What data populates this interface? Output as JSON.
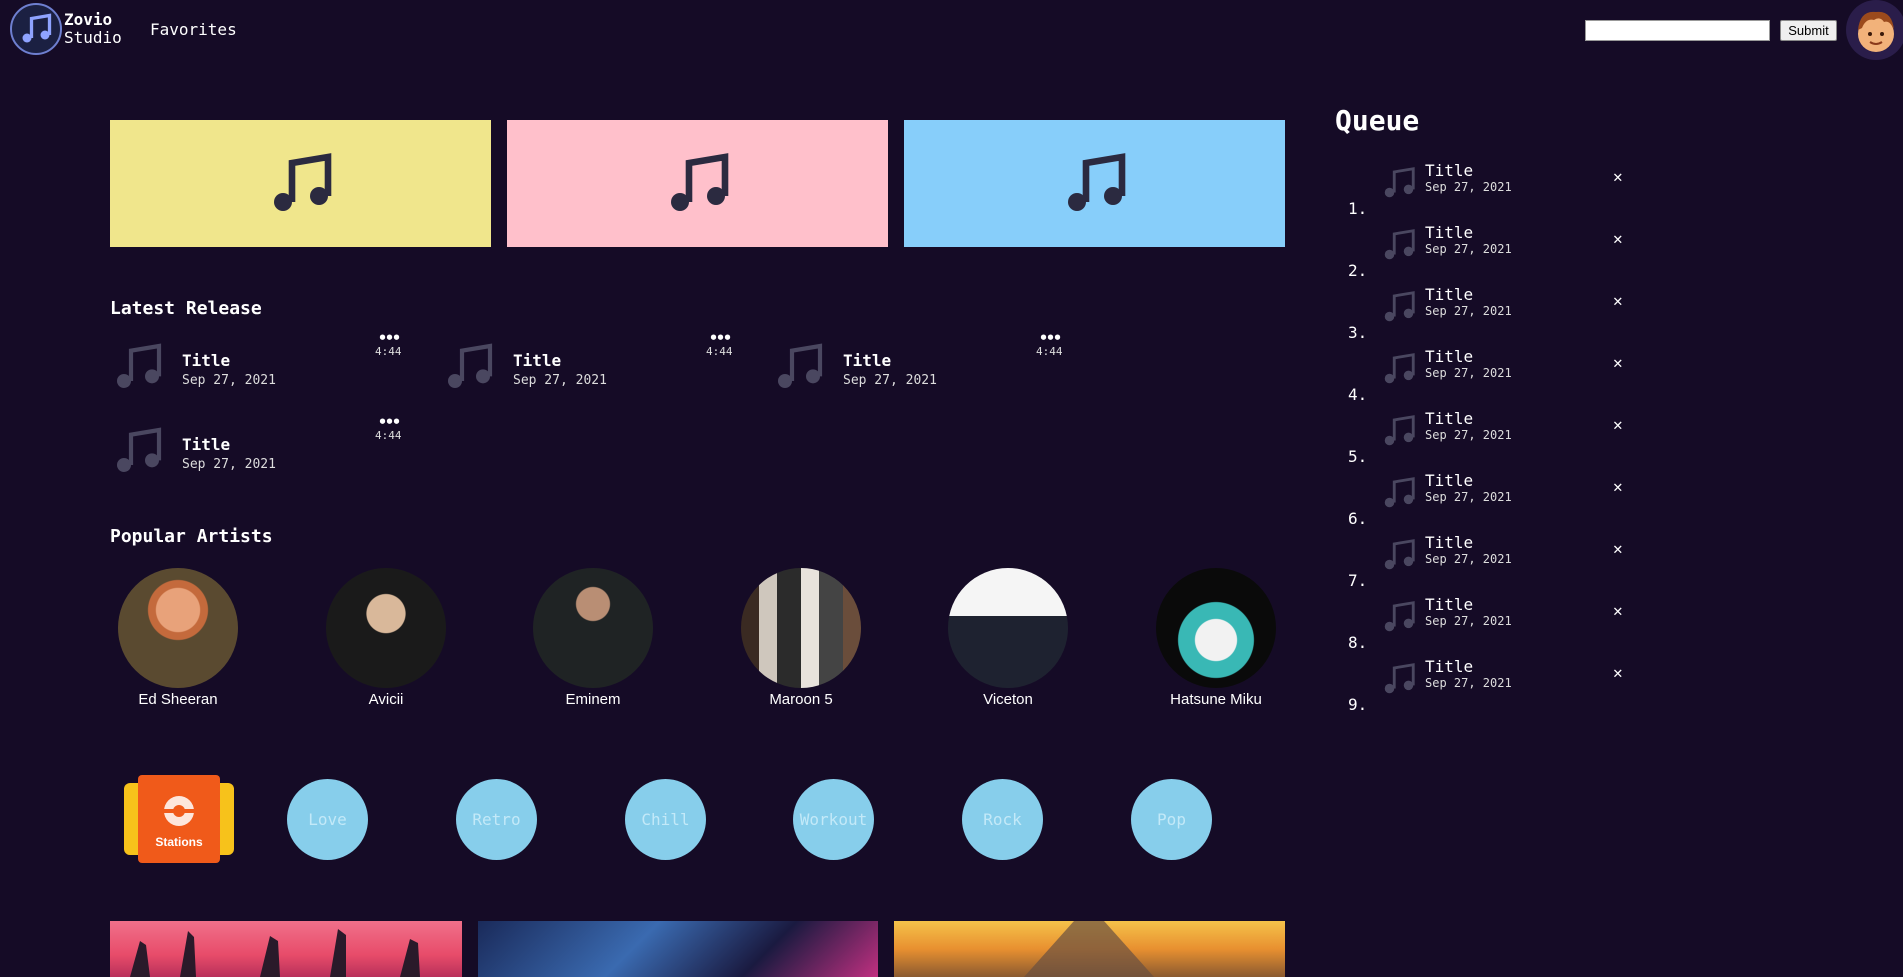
{
  "header": {
    "logo_line1": "Zovio",
    "logo_line2": "Studio",
    "nav_favorites": "Favorites",
    "search_value": "",
    "submit_label": "Submit"
  },
  "featured": [
    {
      "color": "#f0e68c",
      "icon": "music-note-icon"
    },
    {
      "color": "#ffc0cb",
      "icon": "music-note-icon"
    },
    {
      "color": "#87cefa",
      "icon": "music-note-icon"
    }
  ],
  "latest": {
    "title": "Latest Release",
    "items": [
      {
        "title": "Title",
        "date": "Sep 27, 2021",
        "more": "•••",
        "duration": "4:44"
      },
      {
        "title": "Title",
        "date": "Sep 27, 2021",
        "more": "•••",
        "duration": "4:44"
      },
      {
        "title": "Title",
        "date": "Sep 27, 2021",
        "more": "•••",
        "duration": "4:44"
      },
      {
        "title": "Title",
        "date": "Sep 27, 2021",
        "more": "•••",
        "duration": "4:44"
      }
    ]
  },
  "artists": {
    "title": "Popular Artists",
    "items": [
      {
        "name": "Ed Sheeran"
      },
      {
        "name": "Avicii"
      },
      {
        "name": "Eminem"
      },
      {
        "name": "Maroon 5"
      },
      {
        "name": "Viceton"
      },
      {
        "name": "Hatsune Miku"
      }
    ]
  },
  "stations": {
    "label": "Stations"
  },
  "genres": [
    "Love",
    "Retro",
    "Chill",
    "Workout",
    "Rock",
    "Pop"
  ],
  "queue": {
    "title": "Queue",
    "items": [
      {
        "num": "1.",
        "title": "Title",
        "date": "Sep 27, 2021",
        "close": "✕"
      },
      {
        "num": "2.",
        "title": "Title",
        "date": "Sep 27, 2021",
        "close": "✕"
      },
      {
        "num": "3.",
        "title": "Title",
        "date": "Sep 27, 2021",
        "close": "✕"
      },
      {
        "num": "4.",
        "title": "Title",
        "date": "Sep 27, 2021",
        "close": "✕"
      },
      {
        "num": "5.",
        "title": "Title",
        "date": "Sep 27, 2021",
        "close": "✕"
      },
      {
        "num": "6.",
        "title": "Title",
        "date": "Sep 27, 2021",
        "close": "✕"
      },
      {
        "num": "7.",
        "title": "Title",
        "date": "Sep 27, 2021",
        "close": "✕"
      },
      {
        "num": "8.",
        "title": "Title",
        "date": "Sep 27, 2021",
        "close": "✕"
      },
      {
        "num": "9.",
        "title": "Title",
        "date": "Sep 27, 2021",
        "close": "✕"
      }
    ]
  }
}
